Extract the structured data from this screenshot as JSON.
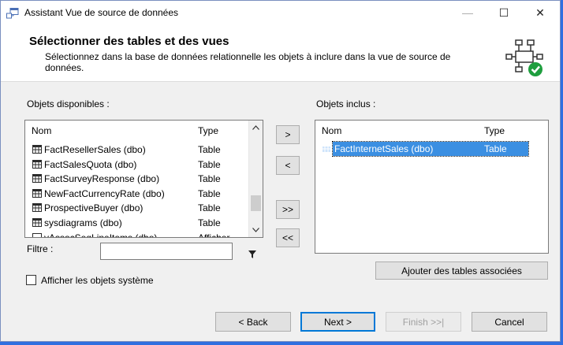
{
  "window": {
    "title": "Assistant Vue de source de données",
    "controls": {
      "minimize": "—",
      "maximize": "☐",
      "close": "✕"
    }
  },
  "header": {
    "title": "Sélectionner des tables et des vues",
    "description": "Sélectionnez dans la base de données relationnelle les objets à inclure dans la vue de source de données.",
    "icon": "data-source-view-check-icon"
  },
  "available": {
    "label": "Objets disponibles :",
    "col_name": "Nom",
    "col_type": "Type",
    "rows": [
      {
        "name": "FactResellerSales (dbo)",
        "type": "Table",
        "icon": "table-icon"
      },
      {
        "name": "FactSalesQuota (dbo)",
        "type": "Table",
        "icon": "table-icon"
      },
      {
        "name": "FactSurveyResponse (dbo)",
        "type": "Table",
        "icon": "table-icon"
      },
      {
        "name": "NewFactCurrencyRate (dbo)",
        "type": "Table",
        "icon": "table-icon"
      },
      {
        "name": "ProspectiveBuyer (dbo)",
        "type": "Table",
        "icon": "table-icon"
      },
      {
        "name": "sysdiagrams (dbo)",
        "type": "Table",
        "icon": "table-icon"
      },
      {
        "name": "vAssocSeqLineItems (dbo)",
        "type": "Afficher",
        "icon": "view-icon"
      }
    ]
  },
  "included": {
    "label": "Objets inclus :",
    "col_name": "Nom",
    "col_type": "Type",
    "rows": [
      {
        "name": "FactInternetSales (dbo)",
        "type": "Table",
        "icon": "table-icon",
        "selected": true
      }
    ]
  },
  "transfer": {
    "add": ">",
    "remove": "<",
    "add_all": ">>",
    "remove_all": "<<"
  },
  "filter": {
    "label": "Filtre :",
    "value": "",
    "placeholder": "",
    "icon": "filter-icon"
  },
  "related_button": "Ajouter des tables associées",
  "show_system": {
    "label": "Afficher les objets système",
    "checked": false
  },
  "nav": {
    "back": "< Back",
    "next": "Next >",
    "finish": "Finish >>|",
    "cancel": "Cancel"
  },
  "colors": {
    "accent": "#0078d7",
    "selection": "#3b8fe2",
    "desktop": "#2f6fe0"
  }
}
